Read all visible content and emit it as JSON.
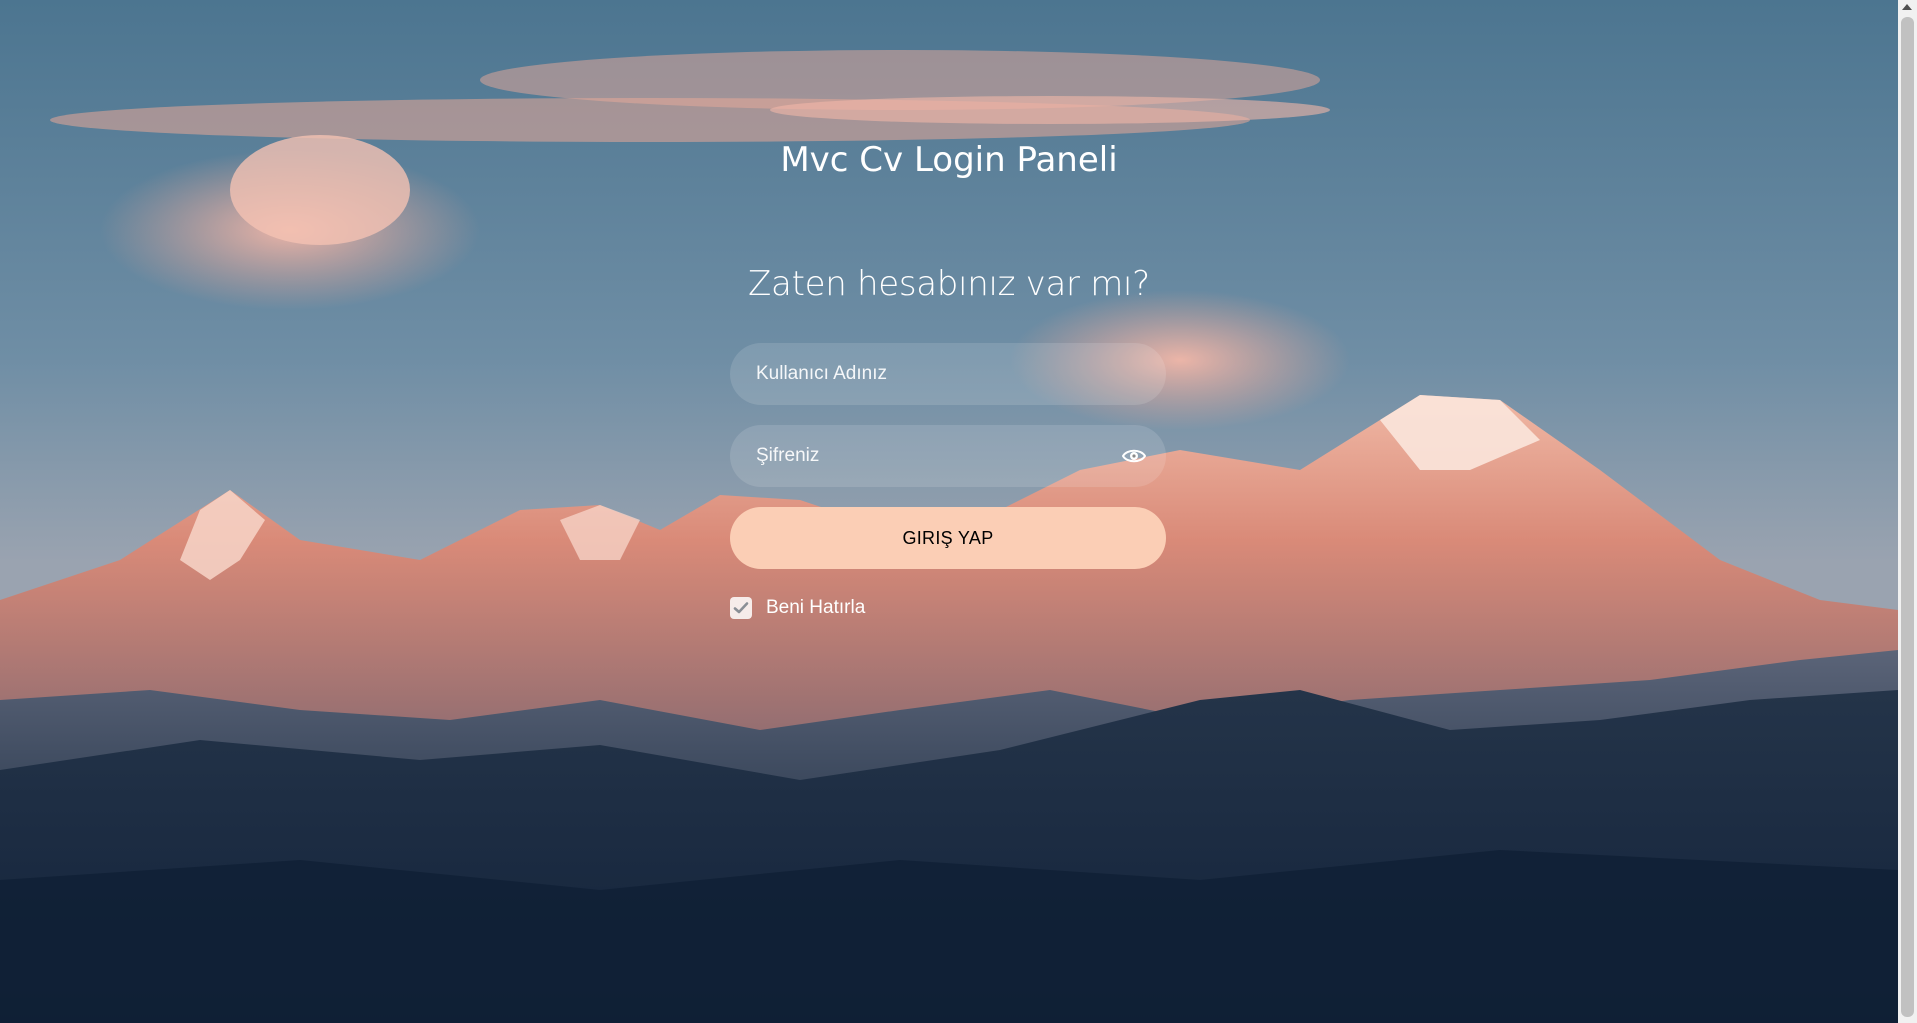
{
  "page": {
    "brand_title": "Mvc Cv Login Paneli",
    "heading": "Zaten hesabınız var mı?"
  },
  "form": {
    "username": {
      "placeholder": "Kullanıcı Adınız",
      "value": ""
    },
    "password": {
      "placeholder": "Şifreniz",
      "value": "",
      "toggle_icon": "eye-icon"
    },
    "submit_label": "GIRIŞ YAP",
    "remember_me": {
      "label": "Beni Hatırla",
      "checked": true,
      "icon": "checkmark-icon"
    }
  },
  "background": {
    "description_icon": "mountain-landscape",
    "sky_color": "#4f7690",
    "peak_color": "#e49a85",
    "valley_color": "#1b2d42"
  },
  "colors": {
    "button_bg": "#fbceb5",
    "text": "#ffffff"
  }
}
